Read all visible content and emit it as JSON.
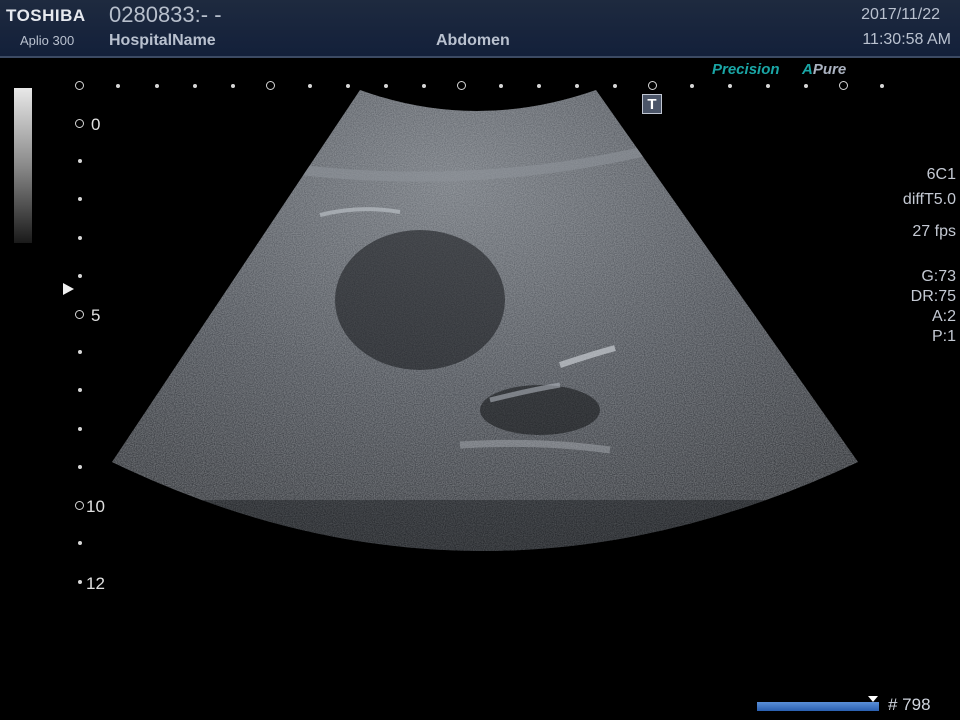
{
  "header": {
    "brand": "TOSHIBA",
    "model": "Aplio 300",
    "patient_id": "0280833:- -",
    "hospital": "HospitalName",
    "preset": "Abdomen",
    "date": "2017/11/22",
    "time": "11:30:58 AM"
  },
  "labels": {
    "precision": "Precision",
    "apure_a": "A",
    "apure_rest": "Pure",
    "t_marker": "T"
  },
  "depth_scale": {
    "labels": [
      "0",
      "5",
      "10",
      "12"
    ]
  },
  "params": {
    "probe": "6C1",
    "mode": "diffT5.0",
    "fps": "27 fps",
    "gain": "G:73",
    "dynamic_range": "DR:75",
    "a": "A:2",
    "p": "P:1"
  },
  "cine": {
    "frame": "# 798",
    "position": 0.95
  },
  "colors": {
    "header_bg": "#1a2640",
    "accent_teal": "#1aa6a6",
    "cine_bar": "#3f78c8"
  }
}
